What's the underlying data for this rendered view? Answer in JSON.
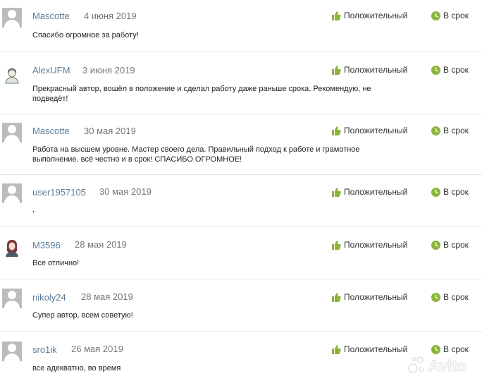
{
  "reviews": [
    {
      "author": "Mascotte",
      "date": "4 июня 2019",
      "rating": "Положительный",
      "timing": "В срок",
      "text": "Спасибо огромное за работу!"
    },
    {
      "author": "AlexUFM",
      "date": "3 июня 2019",
      "rating": "Положительный",
      "timing": "В срок",
      "text": "Прекрасный автор, вошёл в положение и сделал работу даже раньше срока. Рекомендую, не подведёт!"
    },
    {
      "author": "Mascotte",
      "date": "30 мая 2019",
      "rating": "Положительный",
      "timing": "В срок",
      "text": "Работа на высшем уровне. Мастер своего дела. Правильный подход к работе и грамотное выполнение. всё честно и в срок! СПАСИБО ОГРОМНОЕ!"
    },
    {
      "author": "user1957105",
      "date": "30 мая 2019",
      "rating": "Положительный",
      "timing": "В срок",
      "text": ","
    },
    {
      "author": "M3596",
      "date": "28 мая 2019",
      "rating": "Положительный",
      "timing": "В срок",
      "text": "Все отлично!"
    },
    {
      "author": "nikoly24",
      "date": "28 мая 2019",
      "rating": "Положительный",
      "timing": "В срок",
      "text": "Супер автор, всем советую!"
    },
    {
      "author": "sro1ik",
      "date": "26 мая 2019",
      "rating": "Положительный",
      "timing": "В срок",
      "text": "все адекватно, во время"
    }
  ],
  "icons": {
    "rating": "thumbs-up-icon",
    "timing": "clock-icon",
    "avatar_default": "default-user-avatar",
    "accent_green": "#8bb43a",
    "author_color": "#5b7d99"
  },
  "watermark": {
    "text": "Avito"
  }
}
